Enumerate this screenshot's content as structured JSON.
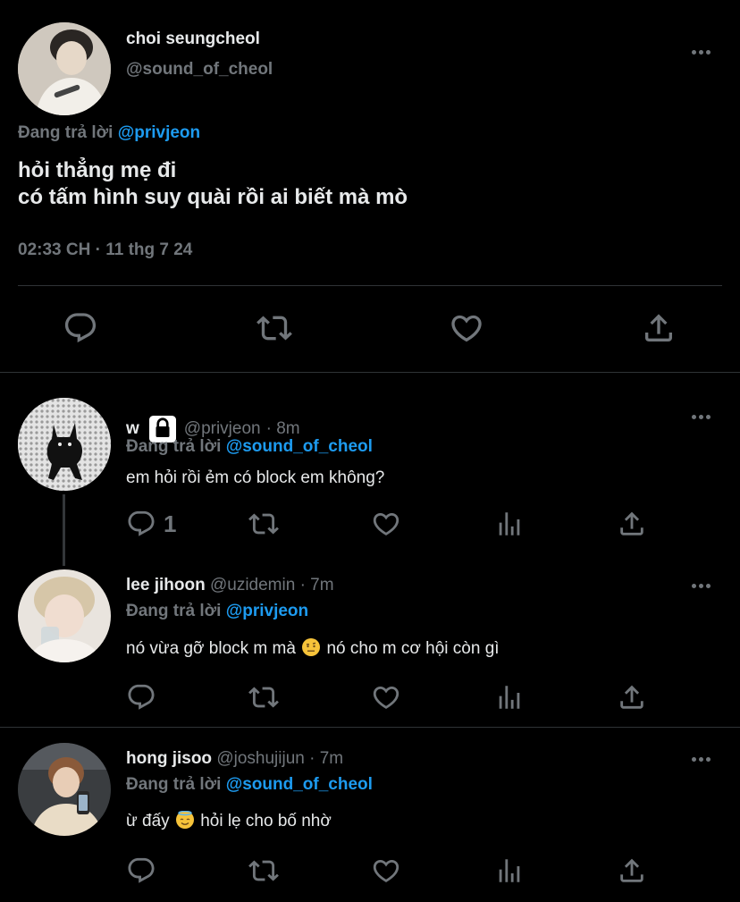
{
  "main_tweet": {
    "display_name": "choi seungcheol",
    "handle": "@sound_of_cheol",
    "replying_prefix": "Đang trả lời",
    "replying_to": "@privjeon",
    "text_line1": "hỏi thẳng mẹ đi",
    "text_line2": "có tấm hình suy quài rồi ai biết mà mò",
    "timestamp": "02:33 CH · 11 thg 7 24"
  },
  "replies": [
    {
      "display_name": "w",
      "handle": "@privjeon",
      "time": "· 8m",
      "replying_prefix": "Đang trả lời",
      "replying_to": "@sound_of_cheol",
      "text": "em hỏi rồi ẻm có block em không?",
      "reply_count": "1"
    },
    {
      "display_name": "lee jihoon",
      "handle": "@uzidemin",
      "time": "· 7m",
      "replying_prefix": "Đang trả lời",
      "replying_to": "@privjeon",
      "text_before": "nó vừa gỡ block m mà",
      "text_after": "nó cho m cơ hội còn gì"
    },
    {
      "display_name": "hong jisoo",
      "handle": "@joshujijun",
      "time": "· 7m",
      "replying_prefix": "Đang trả lời",
      "replying_to": "@sound_of_cheol",
      "text_before": "ừ đấy",
      "text_after": "hỏi lẹ cho bố nhờ"
    }
  ],
  "colors": {
    "accent": "#1d9bf0",
    "muted": "#71767b",
    "divider": "#2f3336",
    "background": "#000000"
  },
  "icons": [
    "reply-icon",
    "retweet-icon",
    "like-icon",
    "views-icon",
    "share-icon",
    "more-icon",
    "lock-icon"
  ]
}
